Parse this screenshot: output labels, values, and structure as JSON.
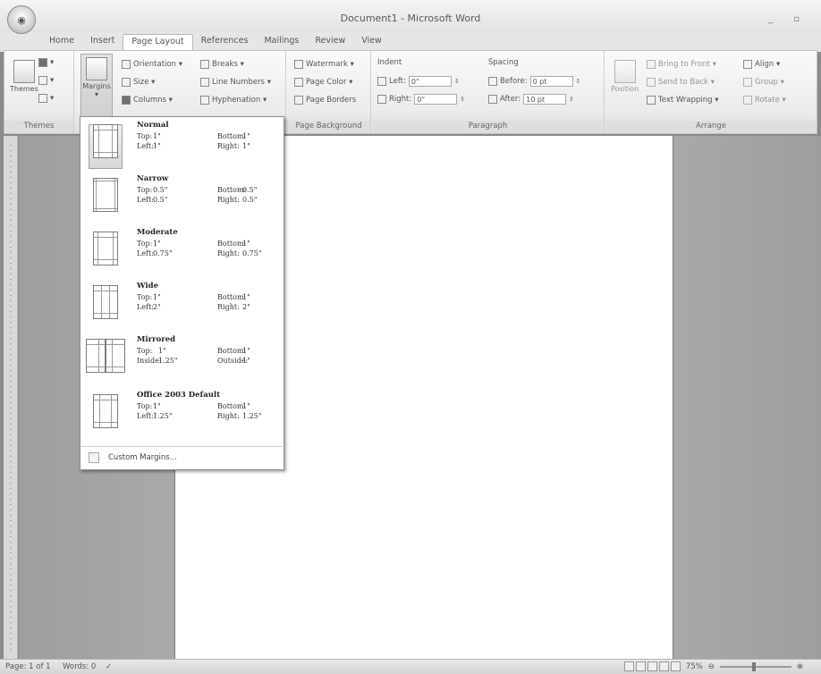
{
  "window": {
    "title": "Document1 - Microsoft Word",
    "controls": "_ ▫"
  },
  "tabs": [
    "Home",
    "Insert",
    "Page Layout",
    "References",
    "Mailings",
    "Review",
    "View"
  ],
  "ribbon": {
    "themes": {
      "themes_label": "Themes",
      "group_label": "Themes"
    },
    "page_setup": {
      "margins_label": "Margins",
      "orientation": "Orientation ▾",
      "size": "Size ▾",
      "columns": "Columns ▾",
      "breaks": "Breaks ▾",
      "line_numbers": "Line Numbers ▾",
      "hyphenation": "Hyphenation ▾"
    },
    "page_background": {
      "watermark": "Watermark ▾",
      "page_color": "Page Color ▾",
      "page_borders": "Page Borders",
      "group_label": "Page Background"
    },
    "paragraph": {
      "indent_label": "Indent",
      "left_label": "Left:",
      "left_value": "0\"",
      "right_label": "Right:",
      "right_value": "0\"",
      "spacing_label": "Spacing",
      "before_label": "Before:",
      "before_value": "0 pt",
      "after_label": "After:",
      "after_value": "10 pt",
      "group_label": "Paragraph"
    },
    "arrange": {
      "position": "Position",
      "bring_to_front": "Bring to Front ▾",
      "send_to_back": "Send to Back ▾",
      "text_wrapping": "Text Wrapping ▾",
      "align": "Align ▾",
      "group": "Group ▾",
      "rotate": "Rotate ▾",
      "group_label": "Arrange"
    }
  },
  "margins_dropdown": {
    "presets": [
      {
        "name": "Normal",
        "r1": [
          "Top:",
          "1\"",
          "Bottom:",
          "1\""
        ],
        "r2": [
          "Left:",
          "1\"",
          "Right:",
          "1\""
        ]
      },
      {
        "name": "Narrow",
        "r1": [
          "Top:",
          "0.5\"",
          "Bottom:",
          "0.5\""
        ],
        "r2": [
          "Left:",
          "0.5\"",
          "Right:",
          "0.5\""
        ]
      },
      {
        "name": "Moderate",
        "r1": [
          "Top:",
          "1\"",
          "Bottom:",
          "1\""
        ],
        "r2": [
          "Left:",
          "0.75\"",
          "Right:",
          "0.75\""
        ]
      },
      {
        "name": "Wide",
        "r1": [
          "Top:",
          "1\"",
          "Bottom:",
          "1\""
        ],
        "r2": [
          "Left:",
          "2\"",
          "Right:",
          "2\""
        ]
      },
      {
        "name": "Mirrored",
        "r1": [
          "Top:",
          "1\"",
          "Bottom:",
          "1\""
        ],
        "r2": [
          "Inside:",
          "1.25\"",
          "Outside:",
          "1\""
        ]
      },
      {
        "name": "Office 2003 Default",
        "r1": [
          "Top:",
          "1\"",
          "Bottom:",
          "1\""
        ],
        "r2": [
          "Left:",
          "1.25\"",
          "Right:",
          "1.25\""
        ]
      }
    ],
    "custom_margins": "Custom Margins..."
  },
  "statusbar": {
    "page": "Page: 1 of 1",
    "words": "Words: 0",
    "zoom": "75%"
  }
}
